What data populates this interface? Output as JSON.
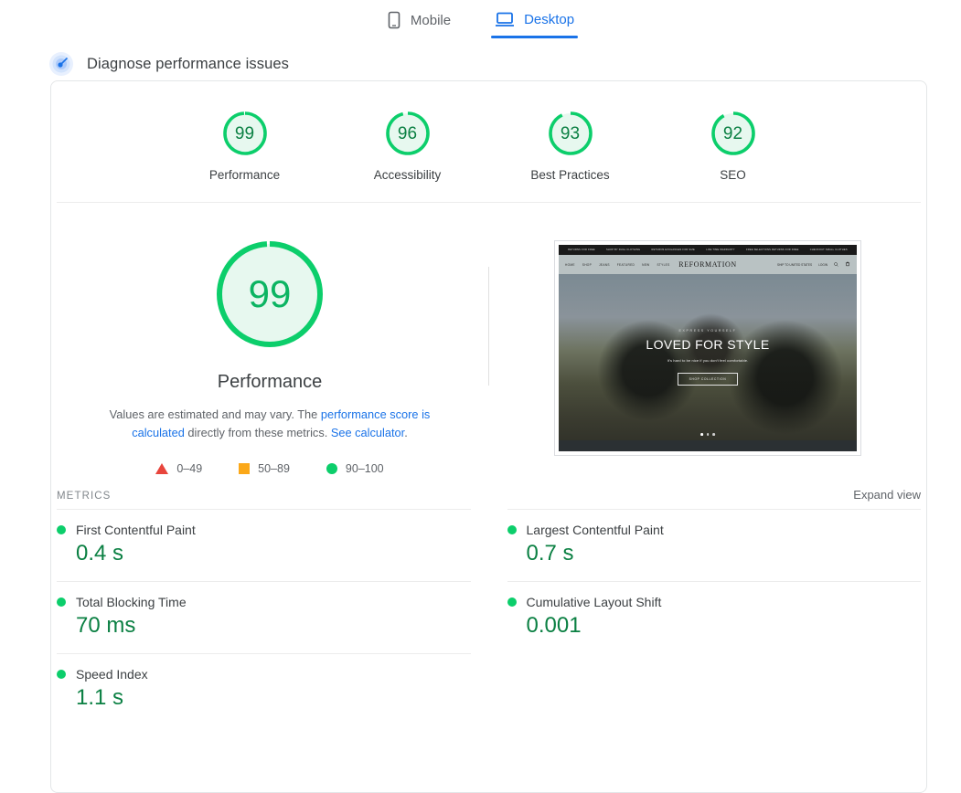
{
  "tabs": [
    {
      "id": "mobile",
      "label": "Mobile",
      "icon": "mobile-phone-icon",
      "active": false
    },
    {
      "id": "desktop",
      "label": "Desktop",
      "icon": "laptop-icon",
      "active": true
    }
  ],
  "diagnose": {
    "icon": "radar-pulse-icon",
    "label": "Diagnose performance issues"
  },
  "categories": [
    {
      "name": "Performance",
      "score": 99,
      "color": "#0cce6b"
    },
    {
      "name": "Accessibility",
      "score": 96,
      "color": "#0cce6b"
    },
    {
      "name": "Best Practices",
      "score": 93,
      "color": "#0cce6b"
    },
    {
      "name": "SEO",
      "score": 92,
      "color": "#0cce6b"
    }
  ],
  "hero": {
    "score": 99,
    "label": "Performance",
    "description_part1": "Values are estimated and may vary. The ",
    "link1": "performance score is calculated",
    "description_part2": " directly from these metrics. ",
    "link2": "See calculator",
    "description_part3": ".",
    "legend": [
      {
        "shape": "triangle",
        "range": "0–49",
        "color": "#e8453c"
      },
      {
        "shape": "square",
        "range": "50–89",
        "color": "#fba819"
      },
      {
        "shape": "circle",
        "range": "90–100",
        "color": "#0cce6b"
      }
    ]
  },
  "screenshot": {
    "announcements": [
      "RETURNS FOR FREE",
      "SHOP BY DUAL CLOTHING",
      "RETURNS EXCHANGES FOR SIZE",
      "LIFE TIME WARRANTY",
      "FREE SELECTIONS RETURNS FOR FREE",
      "CHECKOUT SMALL CLOTHES"
    ],
    "nav_items": [
      "HOME",
      "SHOP",
      "JEANS",
      "FEATURED",
      "NEW",
      "STYLES"
    ],
    "brand": "REFORMATION",
    "nav_right": [
      "SHIP TO UNITED STATES",
      "LOGIN"
    ],
    "hero_eyebrow": "EXPRESS YOURSELF",
    "hero_title": "LOVED FOR STYLE",
    "hero_subtitle": "It's hard to be nice if you don't feel comfortable.",
    "hero_button": "SHOP COLLECTION"
  },
  "metrics_section": {
    "title": "METRICS",
    "expand_label": "Expand view"
  },
  "metrics": [
    {
      "name": "First Contentful Paint",
      "value": "0.4 s",
      "status": "good"
    },
    {
      "name": "Largest Contentful Paint",
      "value": "0.7 s",
      "status": "good"
    },
    {
      "name": "Total Blocking Time",
      "value": "70 ms",
      "status": "good"
    },
    {
      "name": "Cumulative Layout Shift",
      "value": "0.001",
      "status": "good"
    },
    {
      "name": "Speed Index",
      "value": "1.1 s",
      "status": "good"
    }
  ],
  "colors": {
    "good": "#0cce6b",
    "good_text": "#0b8043",
    "average": "#fba819",
    "poor": "#e8453c",
    "link": "#1a73e8"
  }
}
